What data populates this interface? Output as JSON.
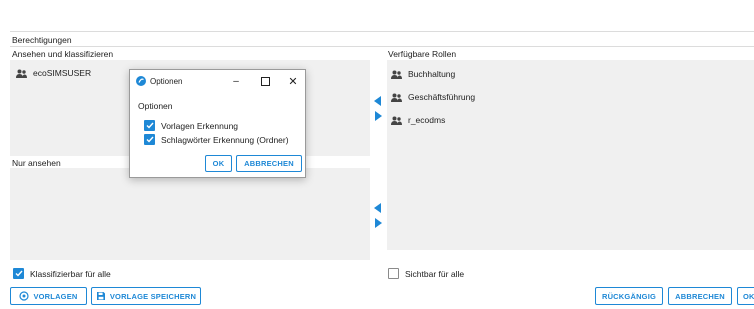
{
  "section_title": "Berechtigungen",
  "left": {
    "view_classify_title": "Ansehen und klassifizieren",
    "view_classify_items": [
      "ecoSIMSUSER"
    ],
    "view_only_title": "Nur ansehen",
    "classifiable_all_label": "Klassifizierbar für alle",
    "classifiable_all_checked": true
  },
  "right": {
    "available_roles_title": "Verfügbare Rollen",
    "roles": [
      "Buchhaltung",
      "Geschäftsführung",
      "r_ecodms"
    ],
    "visible_all_label": "Sichtbar für alle",
    "visible_all_checked": false
  },
  "dialog": {
    "title": "Optionen",
    "section_label": "Optionen",
    "options": [
      {
        "label": "Vorlagen Erkennung",
        "checked": true
      },
      {
        "label": "Schlagwörter Erkennung (Ordner)",
        "checked": true
      }
    ],
    "ok_label": "OK",
    "cancel_label": "ABBRECHEN"
  },
  "footer": {
    "templates_label": "VORLAGEN",
    "save_template_label": "VORLAGE SPEICHERN",
    "undo_label": "RÜCKGÄNGIG",
    "cancel_label": "ABBRECHEN",
    "ok_label": "OK"
  },
  "colors": {
    "accent": "#1e88d6",
    "panel_bg": "#f0f0f0"
  }
}
